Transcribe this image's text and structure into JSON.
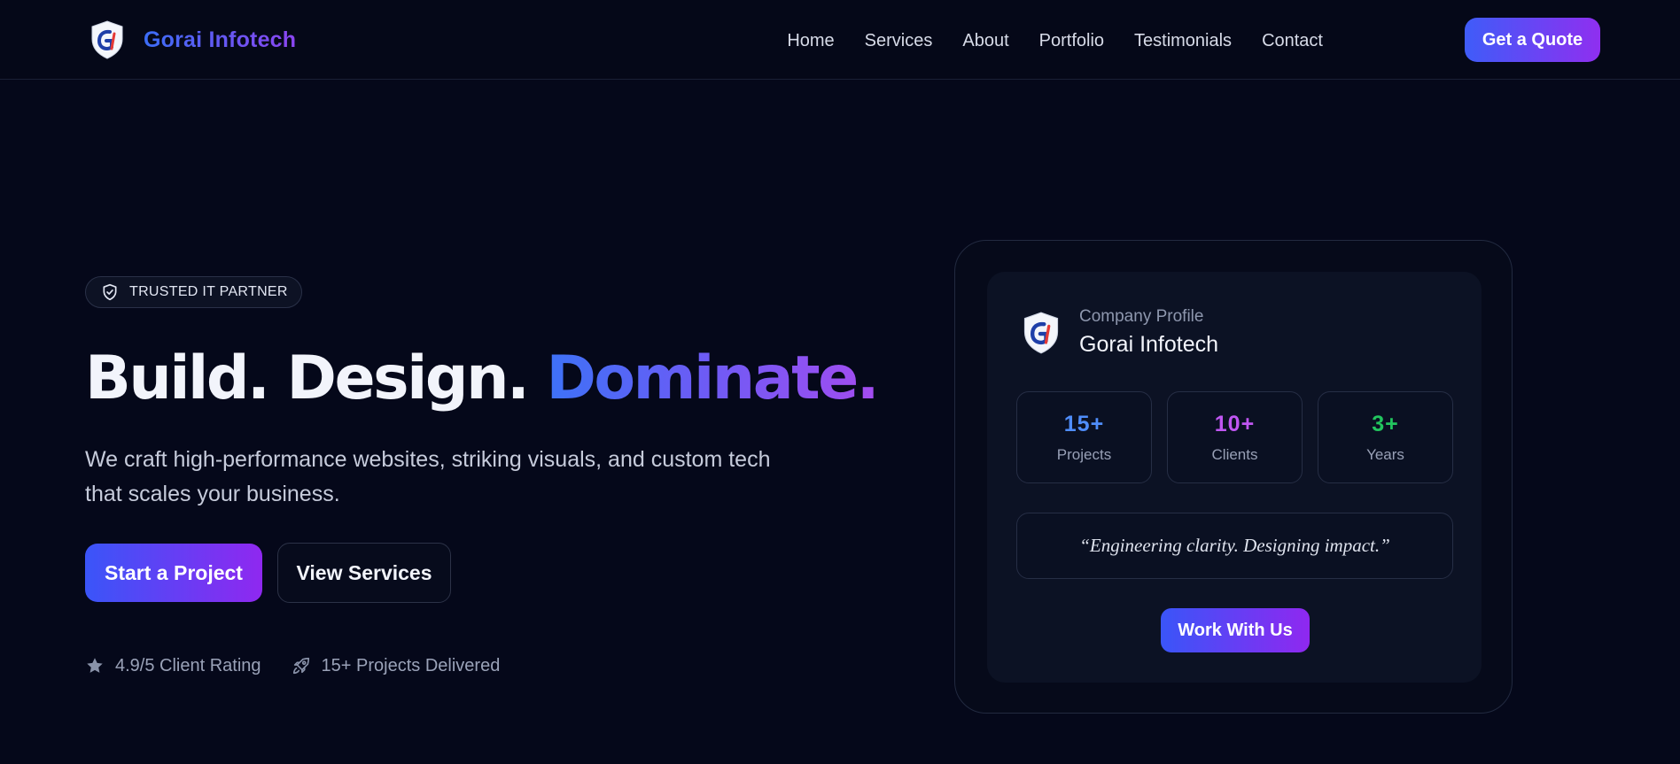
{
  "brand": {
    "name": "Gorai Infotech",
    "logo_icon": "shield-gi-logo",
    "accent_start": "#3b6df6",
    "accent_end": "#8b45f0"
  },
  "nav": {
    "items": [
      "Home",
      "Services",
      "About",
      "Portfolio",
      "Testimonials",
      "Contact"
    ],
    "cta_label": "Get a Quote"
  },
  "hero": {
    "badge": {
      "icon": "shield-check-icon",
      "label": "TRUSTED IT PARTNER"
    },
    "headline_plain": "Build. Design. ",
    "headline_accent": "Dominate.",
    "subtitle": "We craft high-performance websites, striking visuals, and custom tech that scales your business.",
    "primary_cta": "Start a Project",
    "secondary_cta": "View Services",
    "stats": [
      {
        "icon": "star-icon",
        "label": "4.9/5 Client Rating"
      },
      {
        "icon": "rocket-icon",
        "label": "15+ Projects Delivered"
      }
    ]
  },
  "profile_card": {
    "label": "Company Profile",
    "name": "Gorai Infotech",
    "stats": [
      {
        "value": "15+",
        "label": "Projects",
        "color": "#4f8dfa"
      },
      {
        "value": "10+",
        "label": "Clients",
        "color": "#c056f2"
      },
      {
        "value": "3+",
        "label": "Years",
        "color": "#22c55e"
      }
    ],
    "quote": "“Engineering clarity. Designing impact.”",
    "cta": "Work With Us"
  }
}
